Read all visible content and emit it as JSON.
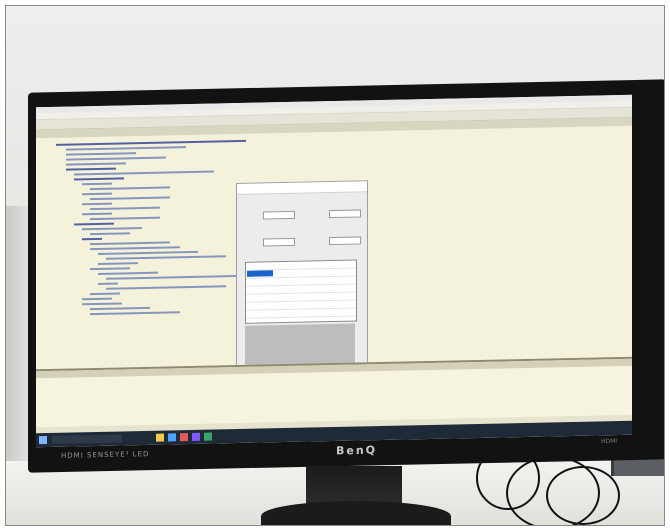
{
  "photo": {
    "description_tags": [
      "monitor-photo",
      "visual-studio-code",
      "winforms-dialog"
    ],
    "monitor": {
      "brand": "BenQ",
      "model_label": "HDMI  SENSEYE³  LED",
      "side_label": "HDMI"
    },
    "colors": {
      "editor_background": "#f5f2dc",
      "keyword": "#1c2f92",
      "selection": "#1a63c9",
      "taskbar": "#1f2a38"
    }
  }
}
